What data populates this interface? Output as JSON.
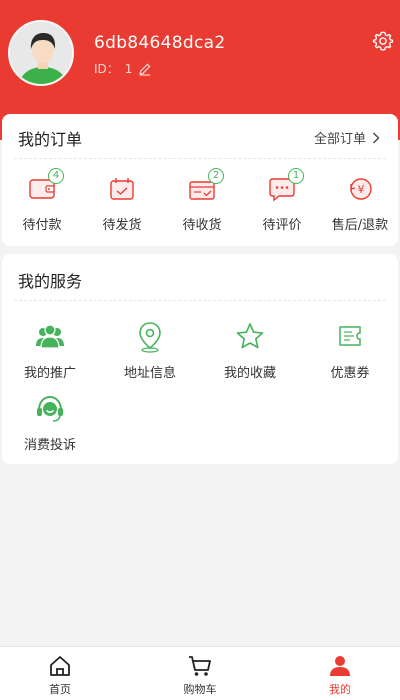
{
  "profile": {
    "username": "6db84648dca2",
    "id_label": "ID：",
    "id_value": "1"
  },
  "orders": {
    "title": "我的订单",
    "all_label": "全部订单",
    "items": [
      {
        "label": "待付款",
        "badge": "4"
      },
      {
        "label": "待发货",
        "badge": ""
      },
      {
        "label": "待收货",
        "badge": "2"
      },
      {
        "label": "待评价",
        "badge": "1"
      },
      {
        "label": "售后/退款",
        "badge": ""
      }
    ]
  },
  "services": {
    "title": "我的服务",
    "items": [
      {
        "label": "我的推广"
      },
      {
        "label": "地址信息"
      },
      {
        "label": "我的收藏"
      },
      {
        "label": "优惠券"
      },
      {
        "label": "消费投诉"
      }
    ]
  },
  "tabbar": {
    "items": [
      {
        "label": "首页"
      },
      {
        "label": "购物车"
      },
      {
        "label": "我的"
      }
    ]
  },
  "colors": {
    "brand_red": "#e93b31",
    "accent_green": "#46b35c"
  }
}
